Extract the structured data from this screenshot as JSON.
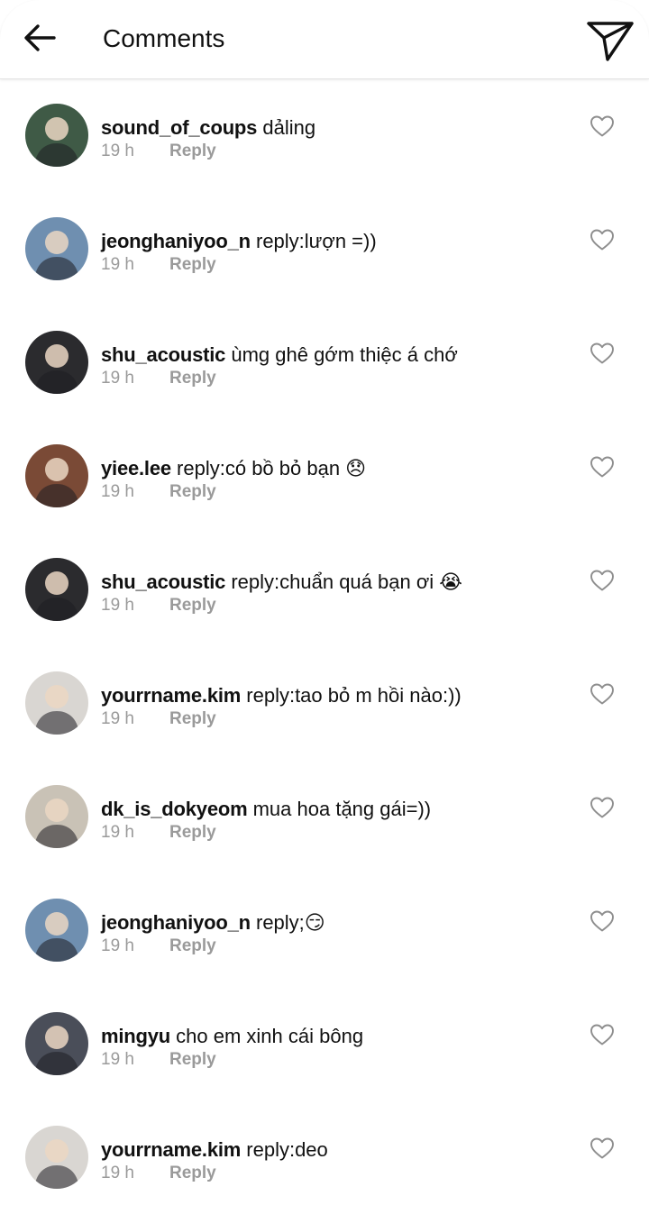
{
  "header": {
    "title": "Comments",
    "back_icon": "arrow-left-icon",
    "send_icon": "paper-plane-icon"
  },
  "reply_label": "Reply",
  "comments": [
    {
      "username": "sound_of_coups",
      "text": "dảling",
      "time": "19 h",
      "avatar_bg": "#3f5a46"
    },
    {
      "username": "jeonghaniyoo_n",
      "text": "reply:lượn =))",
      "time": "19 h",
      "avatar_bg": "#6f8fb0"
    },
    {
      "username": "shu_acoustic",
      "text": "ùmg ghê gớm thiệc á chớ",
      "time": "19 h",
      "avatar_bg": "#2b2b2e"
    },
    {
      "username": "yiee.lee",
      "text": "reply:có bồ bỏ bạn 😞",
      "time": "19 h",
      "avatar_bg": "#7a4a36"
    },
    {
      "username": "shu_acoustic",
      "text": "reply:chuẩn quá bạn ơi 😭",
      "time": "19 h",
      "avatar_bg": "#2b2b2e"
    },
    {
      "username": "yourrname.kim",
      "text": "reply:tao bỏ m hồi nào:))",
      "time": "19 h",
      "avatar_bg": "#d9d6d2"
    },
    {
      "username": "dk_is_dokyeom",
      "text": "mua hoa tặng gái=))",
      "time": "19 h",
      "avatar_bg": "#c9c2b6"
    },
    {
      "username": "jeonghaniyoo_n",
      "text": "reply;😏",
      "time": "19 h",
      "avatar_bg": "#6f8fb0"
    },
    {
      "username": "mingyu",
      "text": "cho em xinh cái bông",
      "time": "19 h",
      "avatar_bg": "#4a4e59"
    },
    {
      "username": "yourrname.kim",
      "text": "reply:deo",
      "time": "19 h",
      "avatar_bg": "#d9d6d2"
    }
  ],
  "colors": {
    "text": "#111111",
    "meta": "#9a9a9a",
    "divider": "#e3e3e3",
    "background": "#ffffff"
  }
}
